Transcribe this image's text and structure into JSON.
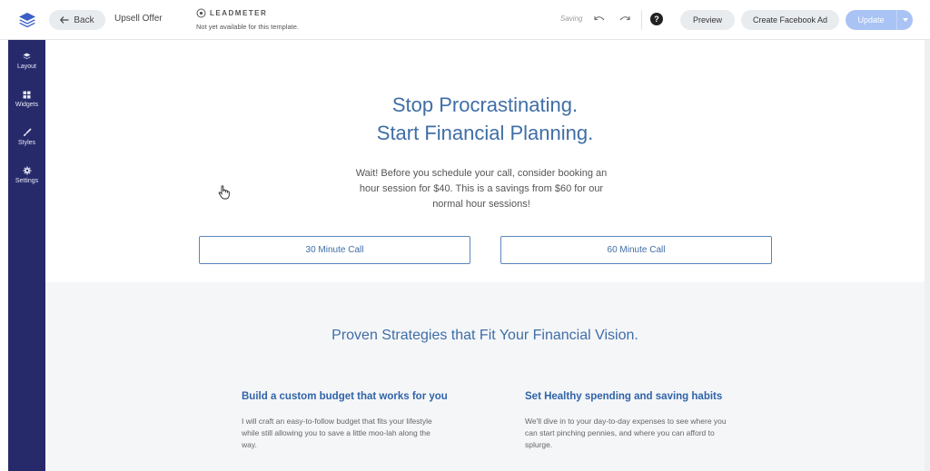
{
  "topbar": {
    "back_label": "Back",
    "page_name": "Upsell Offer",
    "leadmeter_brand": "LEADMETER",
    "leadmeter_note": "Not yet available for this template.",
    "status": "Saving",
    "help_glyph": "?",
    "preview_label": "Preview",
    "facebook_label": "Create Facebook Ad",
    "update_label": "Update"
  },
  "sidebar": {
    "items": [
      {
        "label": "Layout",
        "icon": "layers-icon"
      },
      {
        "label": "Widgets",
        "icon": "grid-icon"
      },
      {
        "label": "Styles",
        "icon": "brush-icon"
      },
      {
        "label": "Settings",
        "icon": "gear-icon"
      }
    ]
  },
  "hero": {
    "title_line1": "Stop Procrastinating.",
    "title_line2": "Start Financial Planning.",
    "body": "Wait! Before you schedule your call, consider booking an hour session for $40. This is a savings from $60 for our normal hour sessions!",
    "cta_1": "30 Minute Call",
    "cta_2": "60 Minute Call"
  },
  "strategies": {
    "title": "Proven Strategies that Fit Your Financial Vision.",
    "features": [
      {
        "heading": "Build a custom budget that works for you",
        "text": "I will craft an easy-to-follow budget that fits your lifestyle while still allowing you to save a little moo-lah along the way."
      },
      {
        "heading": "Set Healthy spending and saving habits",
        "text": "We'll dive in to your day-to-day expenses to see where you can start pinching pennies, and where you can afford to splurge."
      }
    ]
  },
  "colors": {
    "accent": "#3f6ea6",
    "sidebar": "#272a6a",
    "update_button": "#a9c3f5"
  }
}
